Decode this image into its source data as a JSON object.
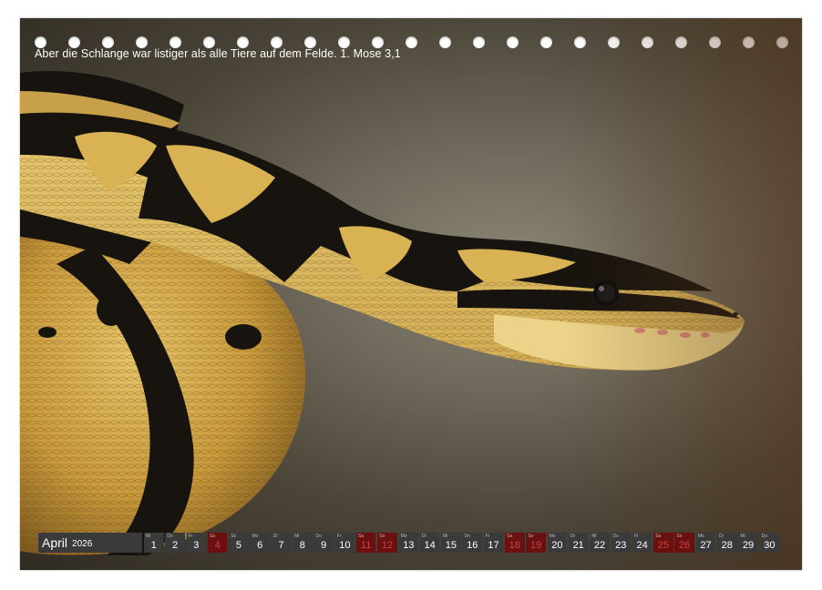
{
  "caption": "Aber die Schlange war listiger als alle Tiere auf dem Felde. 1. Mose 3,1",
  "calendar": {
    "month": "April",
    "year": "2026",
    "days": [
      {
        "wd": "Mi",
        "n": "1"
      },
      {
        "wd": "Do",
        "n": "2"
      },
      {
        "wd": "Fr",
        "n": "3"
      },
      {
        "wd": "Sa",
        "n": "4",
        "hl": true
      },
      {
        "wd": "So",
        "n": "5"
      },
      {
        "wd": "Mo",
        "n": "6"
      },
      {
        "wd": "Di",
        "n": "7"
      },
      {
        "wd": "Mi",
        "n": "8"
      },
      {
        "wd": "Do",
        "n": "9"
      },
      {
        "wd": "Fr",
        "n": "10"
      },
      {
        "wd": "Sa",
        "n": "11",
        "hl": true
      },
      {
        "wd": "So",
        "n": "12",
        "hl": true
      },
      {
        "wd": "Mo",
        "n": "13"
      },
      {
        "wd": "Di",
        "n": "14"
      },
      {
        "wd": "Mi",
        "n": "15"
      },
      {
        "wd": "Do",
        "n": "16"
      },
      {
        "wd": "Fr",
        "n": "17"
      },
      {
        "wd": "Sa",
        "n": "18",
        "hl": true
      },
      {
        "wd": "So",
        "n": "19",
        "hl": true
      },
      {
        "wd": "Mo",
        "n": "20"
      },
      {
        "wd": "Di",
        "n": "21"
      },
      {
        "wd": "Mi",
        "n": "22"
      },
      {
        "wd": "Do",
        "n": "23"
      },
      {
        "wd": "Fr",
        "n": "24"
      },
      {
        "wd": "Sa",
        "n": "25",
        "hl": true
      },
      {
        "wd": "So",
        "n": "26",
        "hl": true
      },
      {
        "wd": "Mo",
        "n": "27"
      },
      {
        "wd": "Di",
        "n": "28"
      },
      {
        "wd": "Mi",
        "n": "29"
      },
      {
        "wd": "Do",
        "n": "30"
      }
    ]
  },
  "colors": {
    "background_dark": "#2f2a22",
    "snake_yellow": "#d9b254",
    "snake_black": "#17130e",
    "weekend": "#6b1010",
    "day_cell": "#3a3a3a"
  },
  "hole_count": 23
}
